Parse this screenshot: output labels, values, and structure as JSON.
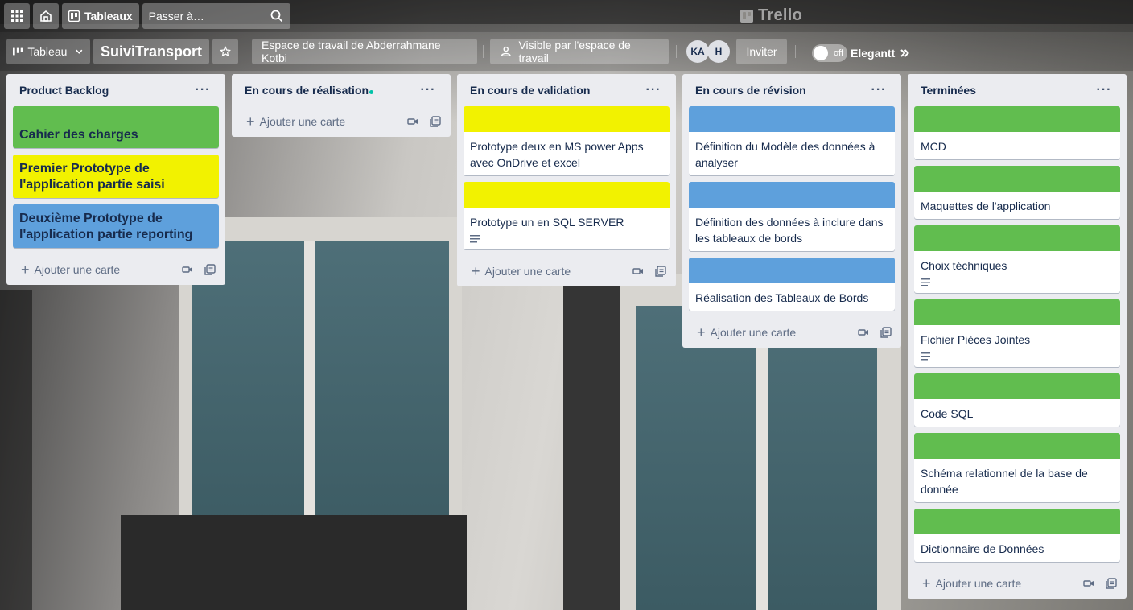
{
  "header": {
    "apps_icon": "grid-icon",
    "home_icon": "home-icon",
    "boards_label": "Tableaux",
    "search_placeholder": "Passer à…",
    "logo_text": "Trello"
  },
  "board": {
    "view_label": "Tableau",
    "title": "SuiviTransport",
    "workspace_label": "Espace de travail de Abderrahmane Kotbi",
    "visibility_label": "Visible par l'espace de travail",
    "members": [
      "KA",
      "H"
    ],
    "invite_label": "Inviter",
    "toggle_label": "off",
    "powerup_label": "Elegantt"
  },
  "colors": {
    "green": "#61bd4f",
    "yellow": "#f2f200",
    "blue": "#5ea0dc"
  },
  "add_card_label": "Ajouter une carte",
  "lists": [
    {
      "title": "Product Backlog",
      "cards": [
        {
          "text": "Cahier des charges",
          "color": "green",
          "style": "full"
        },
        {
          "text": "Premier Prototype de l'application partie saisi",
          "color": "yellow",
          "style": "full"
        },
        {
          "text": "Deuxième Prototype de l'application partie reporting",
          "color": "blue",
          "style": "full"
        }
      ]
    },
    {
      "title": "En cours de réalisation",
      "cards": []
    },
    {
      "title": "En cours de validation",
      "cards": [
        {
          "text": "Prototype deux en MS power Apps avec OnDrive et excel",
          "color": "yellow",
          "style": "cover"
        },
        {
          "text": "Prototype un en SQL SERVER",
          "color": "yellow",
          "style": "cover",
          "description": true
        }
      ]
    },
    {
      "title": "En cours de révision",
      "cards": [
        {
          "text": "Définition du Modèle des données à analyser",
          "color": "blue",
          "style": "cover"
        },
        {
          "text": "Définition des données à inclure dans les tableaux de bords",
          "color": "blue",
          "style": "cover"
        },
        {
          "text": "Réalisation des Tableaux de Bords",
          "color": "blue",
          "style": "cover"
        }
      ]
    },
    {
      "title": "Terminées",
      "cards": [
        {
          "text": "MCD",
          "color": "green",
          "style": "cover"
        },
        {
          "text": "Maquettes de l'application",
          "color": "green",
          "style": "cover"
        },
        {
          "text": "Choix téchniques",
          "color": "green",
          "style": "cover",
          "description": true
        },
        {
          "text": "Fichier Pièces Jointes",
          "color": "green",
          "style": "cover",
          "description": true
        },
        {
          "text": "Code SQL",
          "color": "green",
          "style": "cover"
        },
        {
          "text": "Schéma relationnel de la base de donnée",
          "color": "green",
          "style": "cover"
        },
        {
          "text": "Dictionnaire de Données",
          "color": "green",
          "style": "cover"
        }
      ]
    }
  ]
}
